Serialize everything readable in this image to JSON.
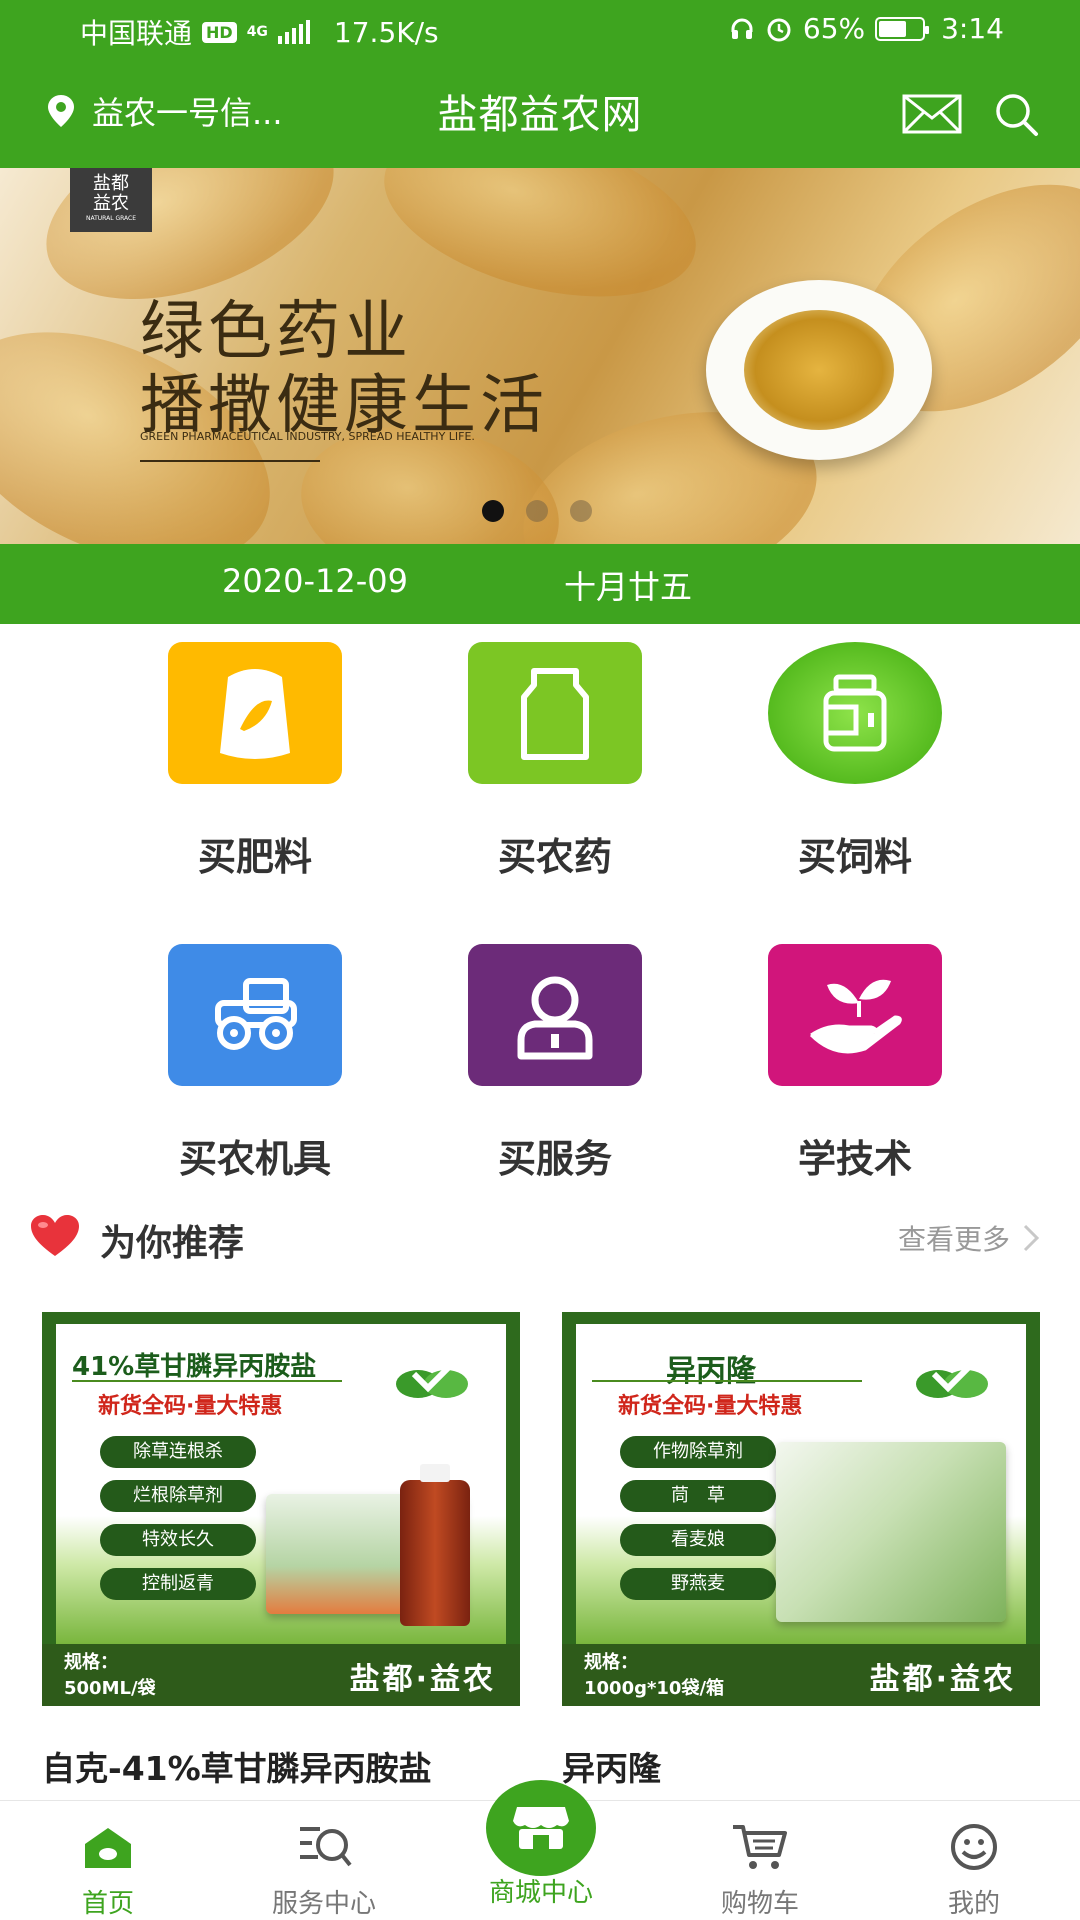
{
  "status_bar": {
    "carrier": "中国联通",
    "hd": "HD",
    "network": "4G",
    "speed": "17.5K/s",
    "battery": "65%",
    "battery_level": 0.65,
    "time": "3:14"
  },
  "header": {
    "location": "益农一号信...",
    "title": "盐都益农网",
    "icons": [
      "location-pin-icon",
      "mail-icon",
      "search-icon"
    ]
  },
  "banner": {
    "brand_line1": "盐都",
    "brand_line2": "益农",
    "brand_tag": "NATURAL GRACE",
    "line1": "绿色药业",
    "line2": "播撒健康生活",
    "english": "GREEN PHARMACEUTICAL INDUSTRY, SPREAD HEALTHY LIFE.",
    "slides": 3,
    "active_slide": 1
  },
  "date_bar": {
    "date": "2020-12-09",
    "lunar": "十月廿五"
  },
  "categories": [
    {
      "label": "买肥料",
      "icon": "fertilizer-bag-icon",
      "color": "#ffba00"
    },
    {
      "label": "买农药",
      "icon": "pesticide-bottle-icon",
      "color": "#7cc624"
    },
    {
      "label": "买饲料",
      "icon": "feed-container-icon",
      "color": "#66c92d"
    },
    {
      "label": "买农机具",
      "icon": "tractor-icon",
      "color": "#3f8be7"
    },
    {
      "label": "买服务",
      "icon": "person-service-icon",
      "color": "#6c2b79"
    },
    {
      "label": "学技术",
      "icon": "sprout-hand-icon",
      "color": "#d1157b"
    }
  ],
  "recommend": {
    "title": "为你推荐",
    "more": "查看更多"
  },
  "products": [
    {
      "img_title": "41%草甘膦异丙胺盐",
      "img_subtitle": "新货全码·量大特惠",
      "tags": [
        "除草连根杀",
        "烂根除草剂",
        "特效长久",
        "控制返青"
      ],
      "spec_label": "规格：",
      "spec": "500ML/袋",
      "brand": "盐都·益农",
      "name": "自克-41%草甘膦异丙胺盐"
    },
    {
      "img_title": "异丙隆",
      "img_subtitle": "新货全码·量大特惠",
      "tags": [
        "作物除草剂",
        "茼　草",
        "看麦娘",
        "野燕麦"
      ],
      "spec_label": "规格：",
      "spec": "1000g*10袋/箱",
      "brand": "盐都·益农",
      "name": "异丙隆"
    }
  ],
  "tabbar": {
    "items": [
      "首页",
      "服务中心",
      "商城中心",
      "购物车",
      "我的"
    ],
    "active": "首页"
  },
  "colors": {
    "brand_green": "#3ea41f",
    "dark_green": "#2e5b1a"
  }
}
